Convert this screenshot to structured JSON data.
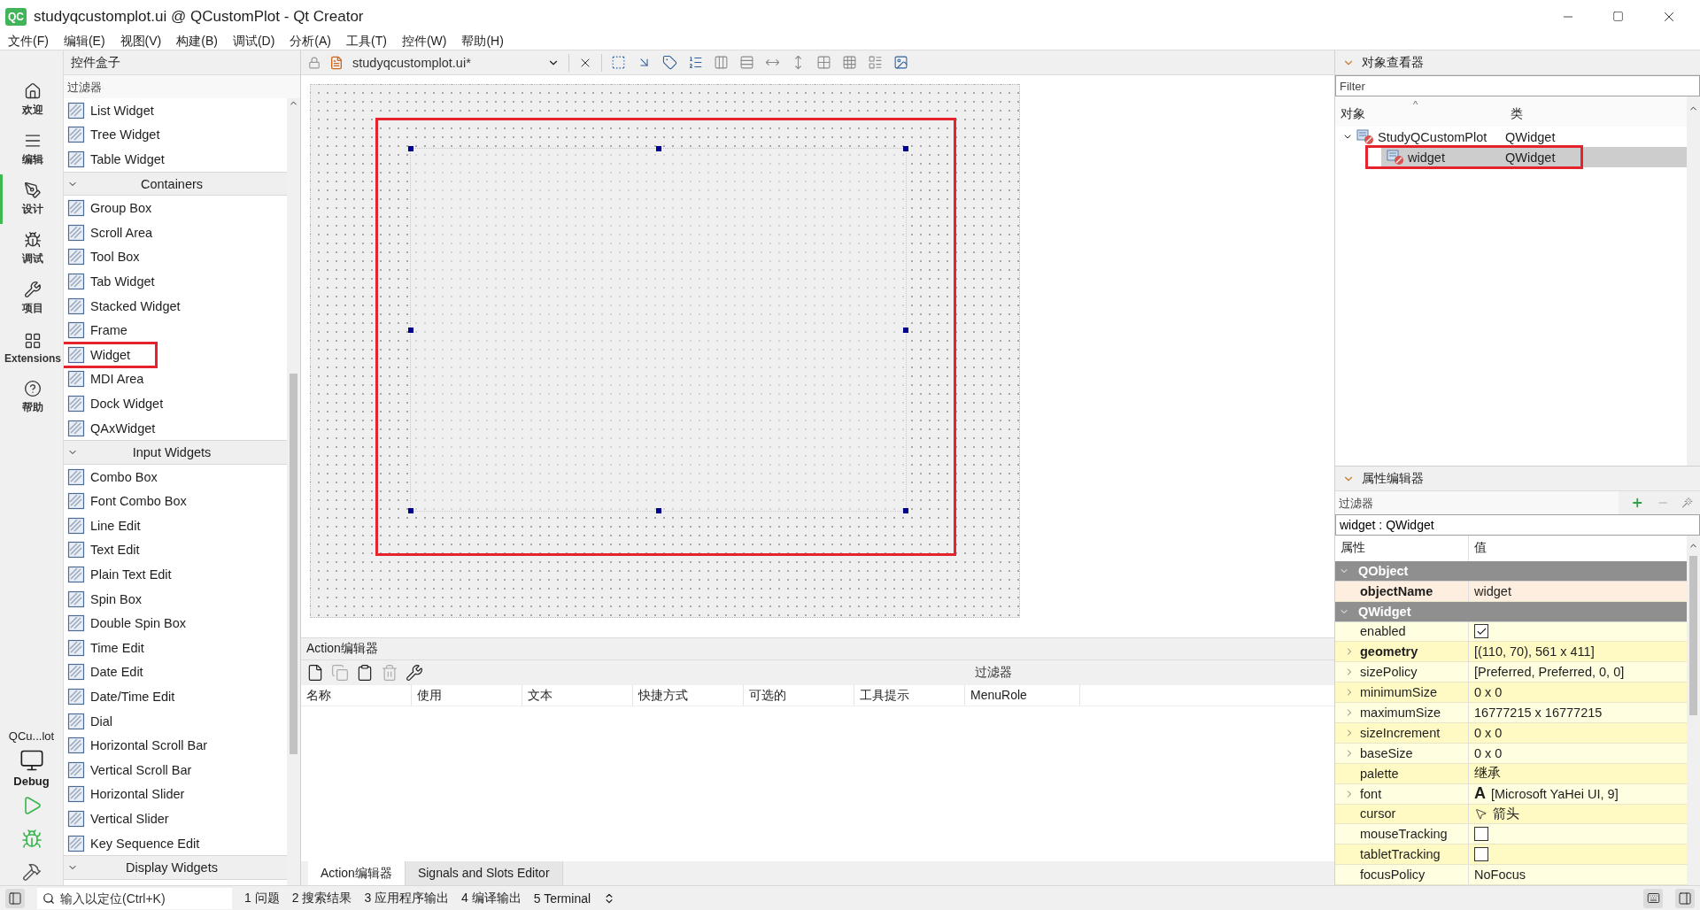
{
  "window": {
    "badge": "QC",
    "title": "studyqcustomplot.ui @ QCustomPlot - Qt Creator"
  },
  "menu": [
    "文件(F)",
    "编辑(E)",
    "视图(V)",
    "构建(B)",
    "调试(D)",
    "分析(A)",
    "工具(T)",
    "控件(W)",
    "帮助(H)"
  ],
  "mode_bar": {
    "items": [
      {
        "label": "欢迎",
        "selected": false
      },
      {
        "label": "编辑",
        "selected": false
      },
      {
        "label": "设计",
        "selected": true
      },
      {
        "label": "调试",
        "selected": false
      },
      {
        "label": "项目",
        "selected": false
      },
      {
        "label": "Extensions",
        "selected": false
      },
      {
        "label": "帮助",
        "selected": false
      }
    ],
    "kit": {
      "project": "QCu...lot",
      "config": "Debug"
    }
  },
  "widget_box": {
    "title": "控件盒子",
    "filter_placeholder": "过滤器",
    "items": [
      {
        "kind": "item",
        "label": "List Widget",
        "annotated": false
      },
      {
        "kind": "item",
        "label": "Tree Widget",
        "annotated": false
      },
      {
        "kind": "item",
        "label": "Table Widget",
        "annotated": false
      },
      {
        "kind": "category",
        "label": "Containers",
        "expanded": true
      },
      {
        "kind": "item",
        "label": "Group Box",
        "annotated": false
      },
      {
        "kind": "item",
        "label": "Scroll Area",
        "annotated": false
      },
      {
        "kind": "item",
        "label": "Tool Box",
        "annotated": false
      },
      {
        "kind": "item",
        "label": "Tab Widget",
        "annotated": false
      },
      {
        "kind": "item",
        "label": "Stacked Widget",
        "annotated": false
      },
      {
        "kind": "item",
        "label": "Frame",
        "annotated": false
      },
      {
        "kind": "item",
        "label": "Widget",
        "annotated": true
      },
      {
        "kind": "item",
        "label": "MDI Area",
        "annotated": false
      },
      {
        "kind": "item",
        "label": "Dock Widget",
        "annotated": false
      },
      {
        "kind": "item",
        "label": "QAxWidget",
        "annotated": false
      },
      {
        "kind": "category",
        "label": "Input Widgets",
        "expanded": true
      },
      {
        "kind": "item",
        "label": "Combo Box",
        "annotated": false
      },
      {
        "kind": "item",
        "label": "Font Combo Box",
        "annotated": false
      },
      {
        "kind": "item",
        "label": "Line Edit",
        "annotated": false
      },
      {
        "kind": "item",
        "label": "Text Edit",
        "annotated": false
      },
      {
        "kind": "item",
        "label": "Plain Text Edit",
        "annotated": false
      },
      {
        "kind": "item",
        "label": "Spin Box",
        "annotated": false
      },
      {
        "kind": "item",
        "label": "Double Spin Box",
        "annotated": false
      },
      {
        "kind": "item",
        "label": "Time Edit",
        "annotated": false
      },
      {
        "kind": "item",
        "label": "Date Edit",
        "annotated": false
      },
      {
        "kind": "item",
        "label": "Date/Time Edit",
        "annotated": false
      },
      {
        "kind": "item",
        "label": "Dial",
        "annotated": false
      },
      {
        "kind": "item",
        "label": "Horizontal Scroll Bar",
        "annotated": false
      },
      {
        "kind": "item",
        "label": "Vertical Scroll Bar",
        "annotated": false
      },
      {
        "kind": "item",
        "label": "Horizontal Slider",
        "annotated": false
      },
      {
        "kind": "item",
        "label": "Vertical Slider",
        "annotated": false
      },
      {
        "kind": "item",
        "label": "Key Sequence Edit",
        "annotated": false
      },
      {
        "kind": "category",
        "label": "Display Widgets",
        "expanded": true
      }
    ]
  },
  "editor": {
    "file_tab": "studyqcustomplot.ui*",
    "form": {
      "widget": {
        "selected": true,
        "annotated": true
      }
    }
  },
  "action_editor": {
    "title": "Action编辑器",
    "filter_label": "过滤器",
    "columns": [
      "名称",
      "使用",
      "文本",
      "快捷方式",
      "可选的",
      "工具提示",
      "MenuRole"
    ],
    "tabs": [
      {
        "label": "Action编辑器",
        "selected": true
      },
      {
        "label": "Signals and Slots Editor",
        "selected": false
      }
    ]
  },
  "object_inspector": {
    "title": "对象查看器",
    "filter_placeholder": "Filter",
    "sort_indicator": "^",
    "columns": [
      "对象",
      "类"
    ],
    "tree": [
      {
        "name": "StudyQCustomPlot",
        "class": "QWidget",
        "expanded": true,
        "selected": false,
        "annotated": false,
        "children": [
          {
            "name": "widget",
            "class": "QWidget",
            "selected": true,
            "annotated": true
          }
        ]
      }
    ]
  },
  "property_editor": {
    "title": "属性编辑器",
    "filter_placeholder": "过滤器",
    "object_label": "widget : QWidget",
    "columns": [
      "属性",
      "值"
    ],
    "groups": [
      {
        "name": "QObject",
        "expanded": true,
        "rows": [
          {
            "name": "objectName",
            "kind": "text",
            "value": "widget",
            "modified": true,
            "expandable": false
          }
        ]
      },
      {
        "name": "QWidget",
        "expanded": true,
        "rows": [
          {
            "name": "enabled",
            "kind": "check",
            "checked": true,
            "modified": false,
            "expandable": false
          },
          {
            "name": "geometry",
            "kind": "text",
            "value": "[(110, 70), 561 x 411]",
            "modified": true,
            "expandable": true
          },
          {
            "name": "sizePolicy",
            "kind": "text",
            "value": "[Preferred, Preferred, 0, 0]",
            "modified": false,
            "expandable": true
          },
          {
            "name": "minimumSize",
            "kind": "text",
            "value": "0 x 0",
            "modified": false,
            "expandable": true
          },
          {
            "name": "maximumSize",
            "kind": "text",
            "value": "16777215 x 16777215",
            "modified": false,
            "expandable": true
          },
          {
            "name": "sizeIncrement",
            "kind": "text",
            "value": "0 x 0",
            "modified": false,
            "expandable": true
          },
          {
            "name": "baseSize",
            "kind": "text",
            "value": "0 x 0",
            "modified": false,
            "expandable": true
          },
          {
            "name": "palette",
            "kind": "text",
            "value": "继承",
            "modified": false,
            "expandable": false
          },
          {
            "name": "font",
            "kind": "font",
            "preview": "A",
            "value": "[Microsoft YaHei UI, 9]",
            "modified": false,
            "expandable": true
          },
          {
            "name": "cursor",
            "kind": "cursor",
            "value": "箭头",
            "modified": false,
            "expandable": false
          },
          {
            "name": "mouseTracking",
            "kind": "check",
            "checked": false,
            "modified": false,
            "expandable": false
          },
          {
            "name": "tabletTracking",
            "kind": "check",
            "checked": false,
            "modified": false,
            "expandable": false
          },
          {
            "name": "focusPolicy",
            "kind": "text",
            "value": "NoFocus",
            "modified": false,
            "expandable": false
          }
        ]
      }
    ]
  },
  "status_bar": {
    "locator_placeholder": "输入以定位(Ctrl+K)",
    "panes": [
      "1 问题",
      "2 搜索结果",
      "3 应用程序输出",
      "4 编译输出",
      "5 Terminal"
    ]
  }
}
